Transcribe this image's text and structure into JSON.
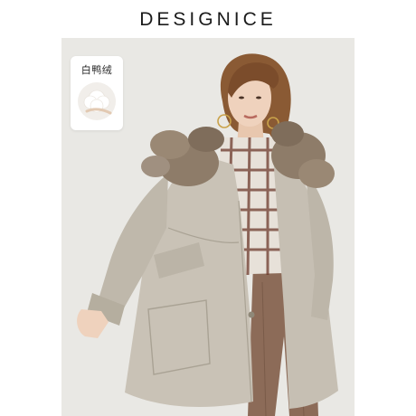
{
  "brand": {
    "logo_text": "DESIGNICE"
  },
  "badge": {
    "label": "白鸭绒",
    "icon": "down-feather-icon"
  },
  "photo": {
    "subject": "product-model-photo"
  },
  "colors": {
    "background": "#e9e8e4",
    "coat": "#c9c2b6",
    "fur": "#8e7c69",
    "hair": "#8a5a34",
    "trousers": "#8c6b58",
    "logo": "#1b1b1b"
  }
}
